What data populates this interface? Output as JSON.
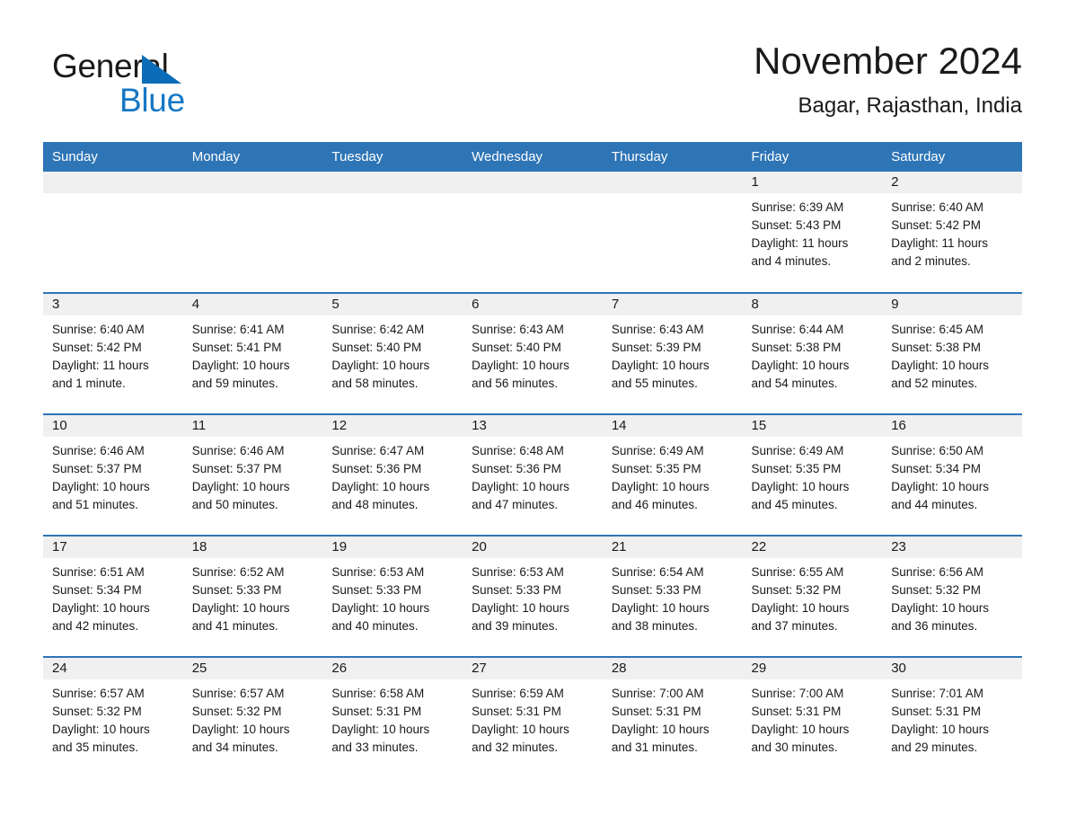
{
  "brand": {
    "name_part1": "General",
    "name_part2": "Blue",
    "triangle_color": "#0b6cb7",
    "blue_text_color": "#1577c4"
  },
  "header": {
    "title": "November 2024",
    "subtitle": "Bagar, Rajasthan, India"
  },
  "theme": {
    "header_blue": "#2e75b6",
    "daynum_gray": "#f0f0f0",
    "text": "#1a1a1a"
  },
  "labels": {
    "sunrise_prefix": "Sunrise: ",
    "sunset_prefix": "Sunset: ",
    "daylight_prefix": "Daylight: "
  },
  "weekdays": [
    "Sunday",
    "Monday",
    "Tuesday",
    "Wednesday",
    "Thursday",
    "Friday",
    "Saturday"
  ],
  "weeks": [
    [
      {
        "day": "",
        "blank": true
      },
      {
        "day": "",
        "blank": true
      },
      {
        "day": "",
        "blank": true
      },
      {
        "day": "",
        "blank": true
      },
      {
        "day": "",
        "blank": true
      },
      {
        "day": "1",
        "sunrise": "Sunrise: 6:39 AM",
        "sunset": "Sunset: 5:43 PM",
        "daylight_l1": "Daylight: 11 hours",
        "daylight_l2": "and 4 minutes."
      },
      {
        "day": "2",
        "sunrise": "Sunrise: 6:40 AM",
        "sunset": "Sunset: 5:42 PM",
        "daylight_l1": "Daylight: 11 hours",
        "daylight_l2": "and 2 minutes."
      }
    ],
    [
      {
        "day": "3",
        "sunrise": "Sunrise: 6:40 AM",
        "sunset": "Sunset: 5:42 PM",
        "daylight_l1": "Daylight: 11 hours",
        "daylight_l2": "and 1 minute."
      },
      {
        "day": "4",
        "sunrise": "Sunrise: 6:41 AM",
        "sunset": "Sunset: 5:41 PM",
        "daylight_l1": "Daylight: 10 hours",
        "daylight_l2": "and 59 minutes."
      },
      {
        "day": "5",
        "sunrise": "Sunrise: 6:42 AM",
        "sunset": "Sunset: 5:40 PM",
        "daylight_l1": "Daylight: 10 hours",
        "daylight_l2": "and 58 minutes."
      },
      {
        "day": "6",
        "sunrise": "Sunrise: 6:43 AM",
        "sunset": "Sunset: 5:40 PM",
        "daylight_l1": "Daylight: 10 hours",
        "daylight_l2": "and 56 minutes."
      },
      {
        "day": "7",
        "sunrise": "Sunrise: 6:43 AM",
        "sunset": "Sunset: 5:39 PM",
        "daylight_l1": "Daylight: 10 hours",
        "daylight_l2": "and 55 minutes."
      },
      {
        "day": "8",
        "sunrise": "Sunrise: 6:44 AM",
        "sunset": "Sunset: 5:38 PM",
        "daylight_l1": "Daylight: 10 hours",
        "daylight_l2": "and 54 minutes."
      },
      {
        "day": "9",
        "sunrise": "Sunrise: 6:45 AM",
        "sunset": "Sunset: 5:38 PM",
        "daylight_l1": "Daylight: 10 hours",
        "daylight_l2": "and 52 minutes."
      }
    ],
    [
      {
        "day": "10",
        "sunrise": "Sunrise: 6:46 AM",
        "sunset": "Sunset: 5:37 PM",
        "daylight_l1": "Daylight: 10 hours",
        "daylight_l2": "and 51 minutes."
      },
      {
        "day": "11",
        "sunrise": "Sunrise: 6:46 AM",
        "sunset": "Sunset: 5:37 PM",
        "daylight_l1": "Daylight: 10 hours",
        "daylight_l2": "and 50 minutes."
      },
      {
        "day": "12",
        "sunrise": "Sunrise: 6:47 AM",
        "sunset": "Sunset: 5:36 PM",
        "daylight_l1": "Daylight: 10 hours",
        "daylight_l2": "and 48 minutes."
      },
      {
        "day": "13",
        "sunrise": "Sunrise: 6:48 AM",
        "sunset": "Sunset: 5:36 PM",
        "daylight_l1": "Daylight: 10 hours",
        "daylight_l2": "and 47 minutes."
      },
      {
        "day": "14",
        "sunrise": "Sunrise: 6:49 AM",
        "sunset": "Sunset: 5:35 PM",
        "daylight_l1": "Daylight: 10 hours",
        "daylight_l2": "and 46 minutes."
      },
      {
        "day": "15",
        "sunrise": "Sunrise: 6:49 AM",
        "sunset": "Sunset: 5:35 PM",
        "daylight_l1": "Daylight: 10 hours",
        "daylight_l2": "and 45 minutes."
      },
      {
        "day": "16",
        "sunrise": "Sunrise: 6:50 AM",
        "sunset": "Sunset: 5:34 PM",
        "daylight_l1": "Daylight: 10 hours",
        "daylight_l2": "and 44 minutes."
      }
    ],
    [
      {
        "day": "17",
        "sunrise": "Sunrise: 6:51 AM",
        "sunset": "Sunset: 5:34 PM",
        "daylight_l1": "Daylight: 10 hours",
        "daylight_l2": "and 42 minutes."
      },
      {
        "day": "18",
        "sunrise": "Sunrise: 6:52 AM",
        "sunset": "Sunset: 5:33 PM",
        "daylight_l1": "Daylight: 10 hours",
        "daylight_l2": "and 41 minutes."
      },
      {
        "day": "19",
        "sunrise": "Sunrise: 6:53 AM",
        "sunset": "Sunset: 5:33 PM",
        "daylight_l1": "Daylight: 10 hours",
        "daylight_l2": "and 40 minutes."
      },
      {
        "day": "20",
        "sunrise": "Sunrise: 6:53 AM",
        "sunset": "Sunset: 5:33 PM",
        "daylight_l1": "Daylight: 10 hours",
        "daylight_l2": "and 39 minutes."
      },
      {
        "day": "21",
        "sunrise": "Sunrise: 6:54 AM",
        "sunset": "Sunset: 5:33 PM",
        "daylight_l1": "Daylight: 10 hours",
        "daylight_l2": "and 38 minutes."
      },
      {
        "day": "22",
        "sunrise": "Sunrise: 6:55 AM",
        "sunset": "Sunset: 5:32 PM",
        "daylight_l1": "Daylight: 10 hours",
        "daylight_l2": "and 37 minutes."
      },
      {
        "day": "23",
        "sunrise": "Sunrise: 6:56 AM",
        "sunset": "Sunset: 5:32 PM",
        "daylight_l1": "Daylight: 10 hours",
        "daylight_l2": "and 36 minutes."
      }
    ],
    [
      {
        "day": "24",
        "sunrise": "Sunrise: 6:57 AM",
        "sunset": "Sunset: 5:32 PM",
        "daylight_l1": "Daylight: 10 hours",
        "daylight_l2": "and 35 minutes."
      },
      {
        "day": "25",
        "sunrise": "Sunrise: 6:57 AM",
        "sunset": "Sunset: 5:32 PM",
        "daylight_l1": "Daylight: 10 hours",
        "daylight_l2": "and 34 minutes."
      },
      {
        "day": "26",
        "sunrise": "Sunrise: 6:58 AM",
        "sunset": "Sunset: 5:31 PM",
        "daylight_l1": "Daylight: 10 hours",
        "daylight_l2": "and 33 minutes."
      },
      {
        "day": "27",
        "sunrise": "Sunrise: 6:59 AM",
        "sunset": "Sunset: 5:31 PM",
        "daylight_l1": "Daylight: 10 hours",
        "daylight_l2": "and 32 minutes."
      },
      {
        "day": "28",
        "sunrise": "Sunrise: 7:00 AM",
        "sunset": "Sunset: 5:31 PM",
        "daylight_l1": "Daylight: 10 hours",
        "daylight_l2": "and 31 minutes."
      },
      {
        "day": "29",
        "sunrise": "Sunrise: 7:00 AM",
        "sunset": "Sunset: 5:31 PM",
        "daylight_l1": "Daylight: 10 hours",
        "daylight_l2": "and 30 minutes."
      },
      {
        "day": "30",
        "sunrise": "Sunrise: 7:01 AM",
        "sunset": "Sunset: 5:31 PM",
        "daylight_l1": "Daylight: 10 hours",
        "daylight_l2": "and 29 minutes."
      }
    ]
  ]
}
